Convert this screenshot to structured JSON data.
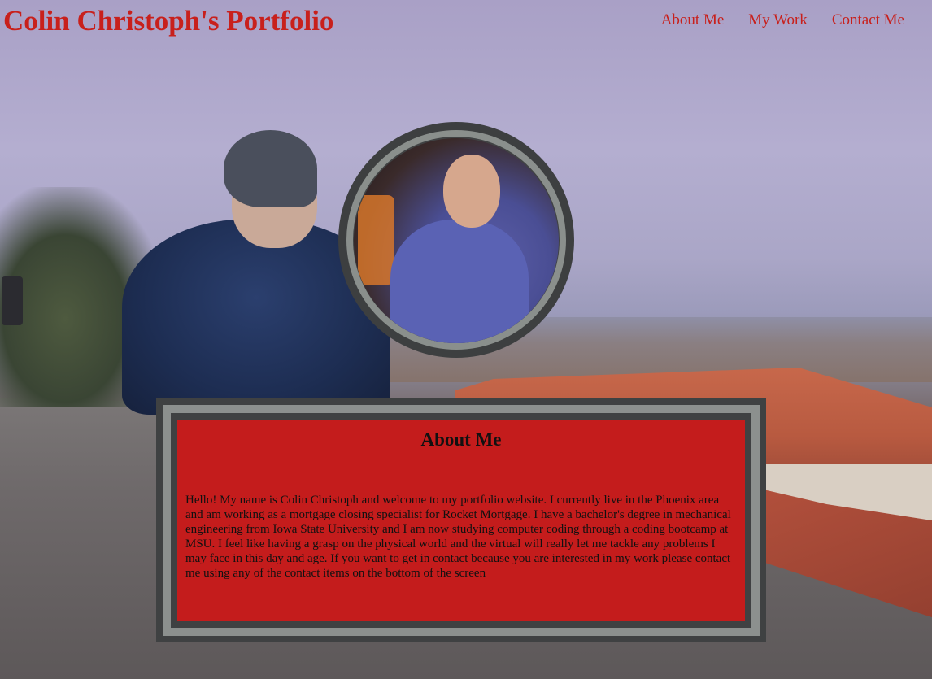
{
  "header": {
    "title": "Colin Christoph's Portfolio",
    "nav": [
      "About Me",
      "My Work",
      "Contact Me"
    ]
  },
  "about": {
    "heading": "About Me",
    "body": "Hello! My name is Colin Christoph and welcome to my portfolio website. I currently live in the Phoenix area and am working as a mortgage closing specialist for Rocket Mortgage. I have a bachelor's degree in mechanical engineering from Iowa State University and I am now studying computer coding through a coding bootcamp at MSU. I feel like having a grasp on the physical world and the virtual will really let me tackle any problems I may face in this day and age. If you want to get in contact because you are interested in my work please contact me using any of the contact items on the bottom of the screen"
  },
  "colors": {
    "accent_red": "#c8201c",
    "card_red": "#c41c1c",
    "frame_dark": "#3f4142",
    "frame_light": "#8c908e"
  }
}
